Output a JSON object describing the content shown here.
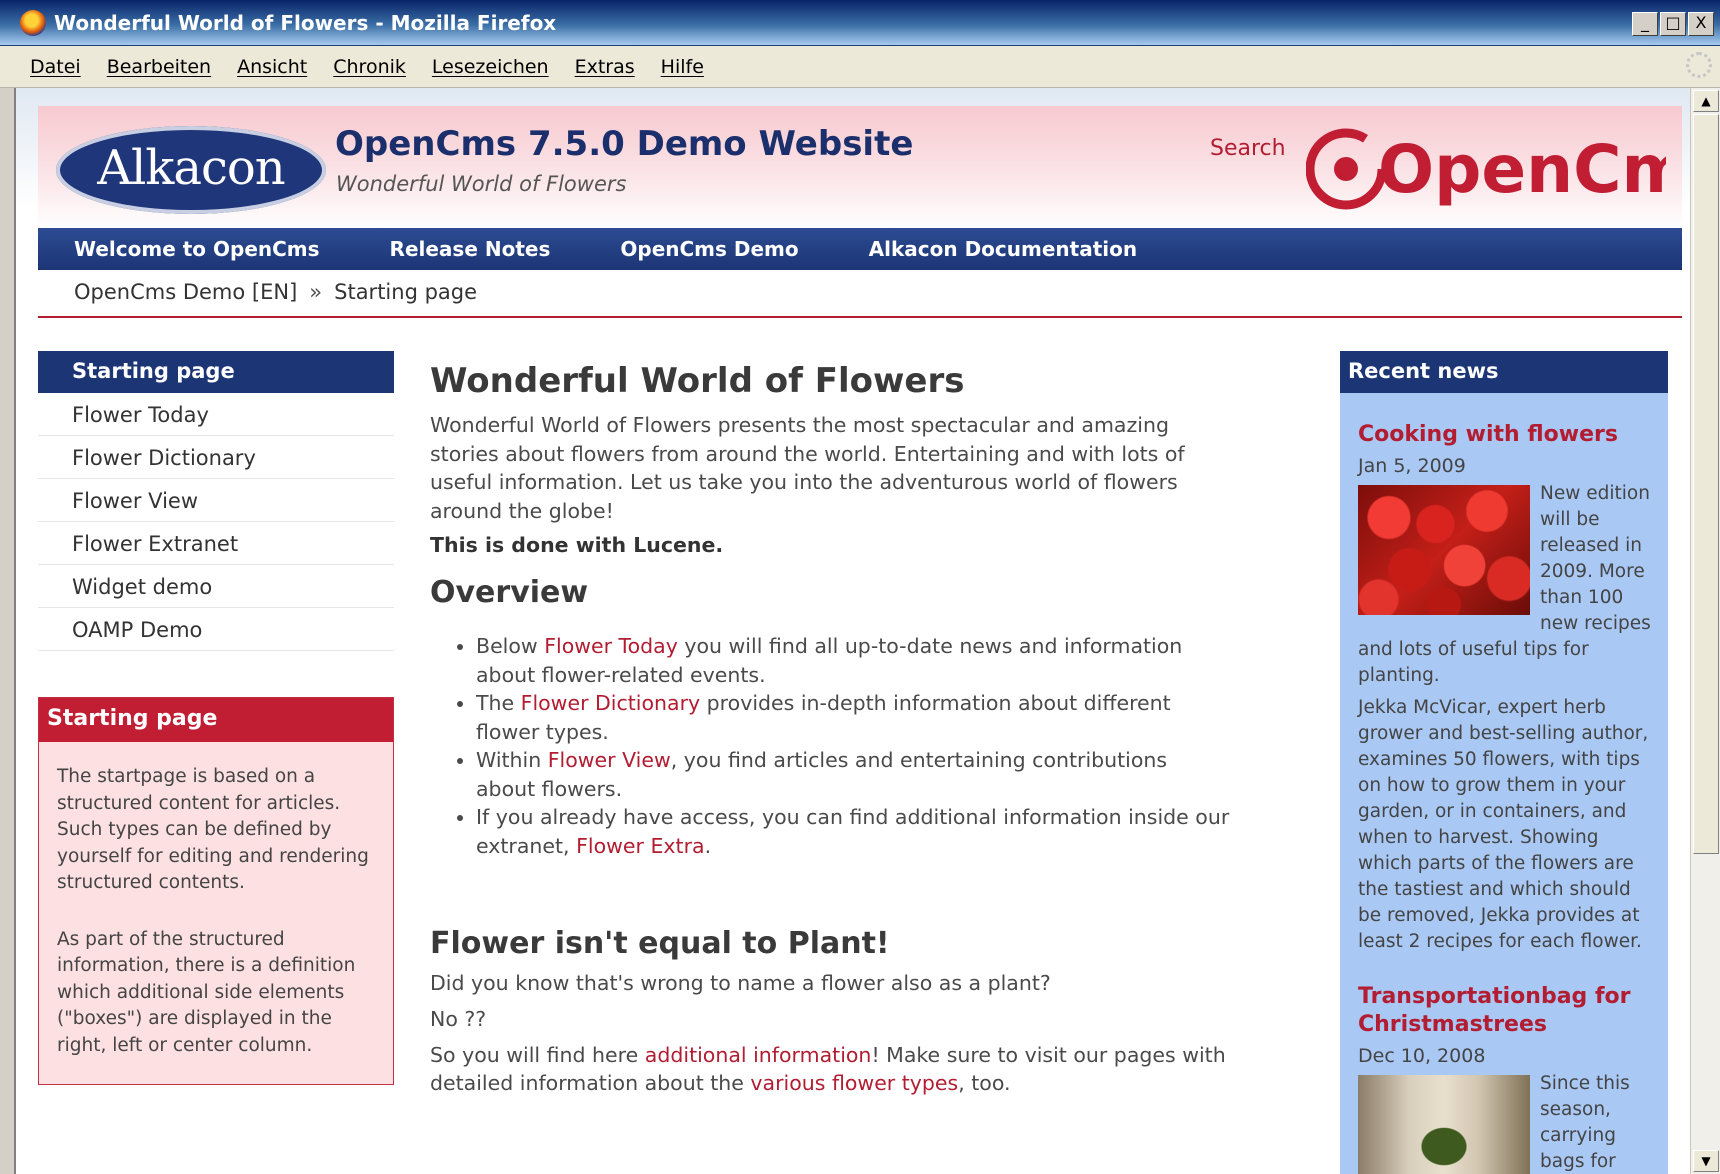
{
  "window": {
    "title": "Wonderful World of Flowers - Mozilla Firefox",
    "buttons": [
      "_",
      "□",
      "X"
    ]
  },
  "menubar": [
    "Datei",
    "Bearbeiten",
    "Ansicht",
    "Chronik",
    "Lesezeichen",
    "Extras",
    "Hilfe"
  ],
  "header": {
    "alkacon_logo": "Alkacon",
    "site_title": "OpenCms 7.5.0 Demo Website",
    "site_subtitle": "Wonderful World of Flowers",
    "search_label": "Search",
    "opencms_logo": "OpenCms",
    "colors": {
      "brand_red": "#b21d32",
      "brand_blue": "#1c3575"
    }
  },
  "nav": [
    "Welcome to OpenCms",
    "Release Notes",
    "OpenCms Demo",
    "Alkacon Documentation"
  ],
  "breadcrumb": {
    "items": [
      "OpenCms Demo [EN]",
      "Starting page"
    ],
    "separator": "»"
  },
  "leftnav": {
    "active": "Starting page",
    "items": [
      "Flower Today",
      "Flower Dictionary",
      "Flower View",
      "Flower Extranet",
      "Widget demo",
      "OAMP Demo"
    ]
  },
  "infobox": {
    "title": "Starting page",
    "paragraphs": [
      "The startpage is based on a structured content for articles. Such types can be defined by yourself for editing and rendering structured contents.",
      "As part of the structured information, there is a definition which additional side elements (\"boxes\") are displayed in the right, left or center column."
    ]
  },
  "main": {
    "title": "Wonderful World of Flowers",
    "intro": "Wonderful World of Flowers presents the most spectacular and amazing stories about flowers from around the world. Entertaining and with lots of useful information. Let us take you into the adventurous world of flowers around the globe!",
    "strong_line": "This is done with Lucene.",
    "overview_title": "Overview",
    "bullets": [
      {
        "pre": "Below ",
        "link": "Flower Today",
        "post": " you will find all up-to-date news and information about flower-related events."
      },
      {
        "pre": "The ",
        "link": "Flower Dictionary",
        "post": " provides in-depth information about different flower types."
      },
      {
        "pre": "Within ",
        "link": "Flower View",
        "post": ", you find articles and entertaining contributions about flowers."
      },
      {
        "pre": "If you already have access, you can find additional information inside our extranet, ",
        "link": "Flower Extra",
        "post": "."
      }
    ],
    "second_title": "Flower isn't equal to Plant!",
    "para1": "Did you know that's wrong to name a flower also as a plant?",
    "para2": "No ??",
    "para3": {
      "pre": "So you will find here ",
      "link1": "additional information",
      "mid": "! Make sure to visit our pages with detailed information about the ",
      "link2": "various flower types",
      "post": ", too."
    }
  },
  "news": {
    "heading": "Recent news",
    "items": [
      {
        "title": "Cooking with flowers",
        "date": "Jan 5, 2009",
        "image": "strawberries-image",
        "body1": "New edition will be released in 2009. More than 100 new recipes and lots of useful tips for planting.",
        "body2": "Jekka McVicar, expert herb grower and best-selling author, examines 50 flowers, with tips on how to grow them in your garden, or in containers, and when to harvest. Showing which parts of the flowers are the tastiest and which should be removed, Jekka provides at least 2 recipes for each flower."
      },
      {
        "title": "Transportationbag for Christmastrees",
        "date": "Dec 10, 2008",
        "image": "christmas-tree-image",
        "body1": "Since this season, carrying bags for christmas"
      }
    ]
  }
}
